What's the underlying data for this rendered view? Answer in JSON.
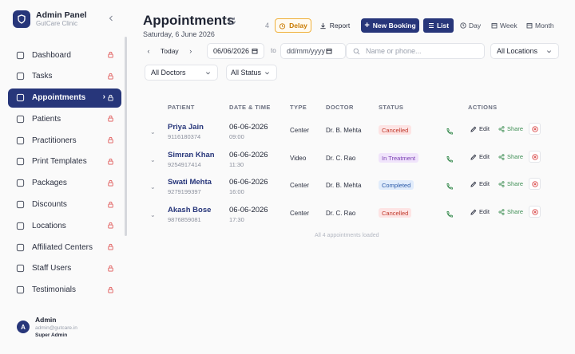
{
  "brand": {
    "title": "Admin Panel",
    "subtitle": "GutCare Clinic"
  },
  "nav": [
    {
      "label": "Dashboard",
      "icon": "dashboard-icon"
    },
    {
      "label": "Tasks",
      "icon": "clipboard-icon"
    },
    {
      "label": "Appointments",
      "icon": "calendar-icon",
      "active": true
    },
    {
      "label": "Patients",
      "icon": "user-icon"
    },
    {
      "label": "Practitioners",
      "icon": "users-icon"
    },
    {
      "label": "Print Templates",
      "icon": "printer-icon"
    },
    {
      "label": "Packages",
      "icon": "package-icon"
    },
    {
      "label": "Discounts",
      "icon": "tag-icon"
    },
    {
      "label": "Locations",
      "icon": "map-pin-icon"
    },
    {
      "label": "Affiliated Centers",
      "icon": "building-icon"
    },
    {
      "label": "Staff Users",
      "icon": "user-gear-icon"
    },
    {
      "label": "Testimonials",
      "icon": "message-icon"
    }
  ],
  "user": {
    "initial": "A",
    "name": "Admin",
    "email": "admin@gutcare.in",
    "role": "Super Admin"
  },
  "header": {
    "title": "Appointments",
    "date": "Saturday, 6 June 2026",
    "count": "4",
    "delay_label": "Delay",
    "report_label": "Report",
    "new_label": "New Booking",
    "views": {
      "list": "List",
      "day": "Day",
      "week": "Week",
      "month": "Month"
    }
  },
  "filters": {
    "today_label": "Today",
    "date_from": "06/06/2026",
    "to_label": "to",
    "date_to": "dd/mm/yyyy",
    "search_placeholder": "Name or phone...",
    "location": "All Locations",
    "doctor": "All Doctors",
    "status": "All Status"
  },
  "table": {
    "columns": {
      "patient": "PATIENT",
      "datetime": "DATE & TIME",
      "type": "TYPE",
      "doctor": "DOCTOR",
      "status": "STATUS",
      "actions": "ACTIONS"
    },
    "rows": [
      {
        "name": "Priya Jain",
        "phone": "9116180374",
        "date": "06-06-2026",
        "time": "09:00",
        "type": "Center",
        "doctor": "Dr. B. Mehta",
        "status": "Cancelled"
      },
      {
        "name": "Simran Khan",
        "phone": "9254917414",
        "date": "06-06-2026",
        "time": "11:30",
        "type": "Video",
        "doctor": "Dr. C. Rao",
        "status": "In Treatment"
      },
      {
        "name": "Swati Mehta",
        "phone": "9279199397",
        "date": "06-06-2026",
        "time": "16:00",
        "type": "Center",
        "doctor": "Dr. B. Mehta",
        "status": "Completed"
      },
      {
        "name": "Akash Bose",
        "phone": "9876859081",
        "date": "06-06-2026",
        "time": "17:30",
        "type": "Center",
        "doctor": "Dr. C. Rao",
        "status": "Cancelled"
      }
    ],
    "edit_label": "Edit",
    "share_label": "Share",
    "footer": "All 4 appointments loaded"
  },
  "colors": {
    "primary": "#27367a",
    "cancelled_bg": "#fde4e4",
    "cancelled_fg": "#c0392b",
    "treatment_bg": "#f0e4fb",
    "treatment_fg": "#7a3fb2",
    "completed_bg": "#e1ecfb",
    "completed_fg": "#2b5aa8",
    "lock": "#e05a5a"
  }
}
